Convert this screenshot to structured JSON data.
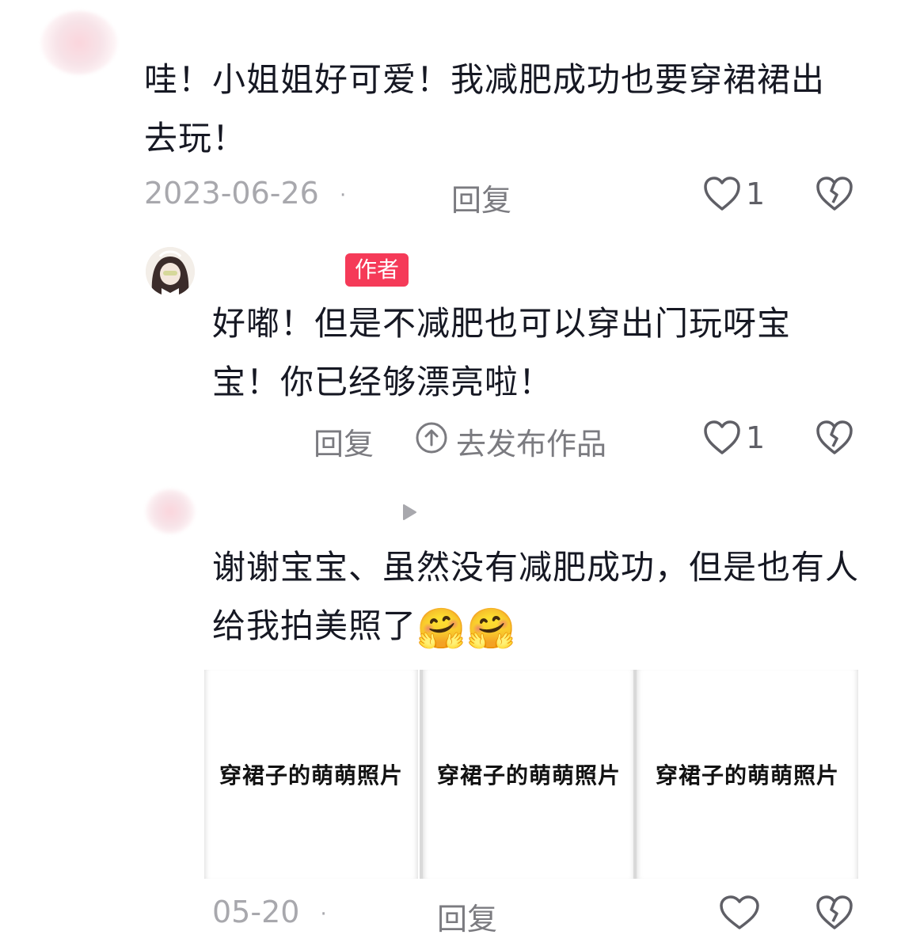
{
  "comment1": {
    "text": "哇！小姐姐好可爱！我减肥成功也要穿裙裙出去玩！",
    "date": "2023-06-26",
    "dot": "·",
    "reply": "回复",
    "like_count": "1"
  },
  "reply1": {
    "author_tag": "作者",
    "text": "好嘟！但是不减肥也可以穿出门玩呀宝宝！你已经够漂亮啦！",
    "reply": "回复",
    "publish": "去发布作品",
    "like_count": "1"
  },
  "reply2": {
    "text": "谢谢宝宝、虽然没有减肥成功，但是也有人给我拍美照了",
    "emojis": [
      "🤗",
      "🤗"
    ],
    "images": [
      {
        "caption": "穿裙子的萌萌照片"
      },
      {
        "caption": "穿裙子的萌萌照片"
      },
      {
        "caption": "穿裙子的萌萌照片"
      }
    ],
    "date": "05-20",
    "dot": "·",
    "reply": "回复"
  },
  "icons": {
    "like": "heart-outline-icon",
    "dislike": "broken-heart-icon",
    "arrow": "play-arrow-icon",
    "upload": "upload-circle-icon"
  },
  "colors": {
    "author_tag": "#f53a58",
    "meta": "#a8a8ad",
    "text": "#161823"
  }
}
